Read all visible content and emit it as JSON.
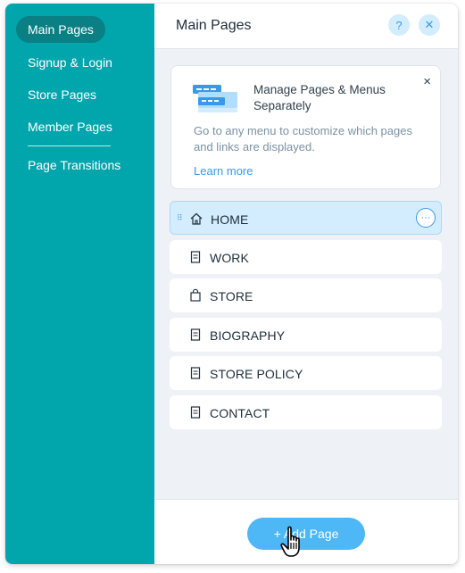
{
  "sidebar": {
    "items": [
      {
        "label": "Main Pages",
        "active": true
      },
      {
        "label": "Signup & Login",
        "active": false
      },
      {
        "label": "Store Pages",
        "active": false
      },
      {
        "label": "Member Pages",
        "active": false
      },
      {
        "label": "Page Transitions",
        "active": false
      }
    ]
  },
  "header": {
    "title": "Main Pages",
    "help_icon": "?",
    "close_icon": "✕"
  },
  "info_card": {
    "heading": "Manage Pages & Menus Separately",
    "body": "Go to any menu to customize which pages and links are displayed.",
    "link": "Learn more",
    "close_icon": "×"
  },
  "pages": [
    {
      "label": "HOME",
      "icon": "home-icon",
      "selected": true
    },
    {
      "label": "WORK",
      "icon": "page-icon",
      "selected": false
    },
    {
      "label": "STORE",
      "icon": "shopping-bag-icon",
      "selected": false
    },
    {
      "label": "BIOGRAPHY",
      "icon": "page-icon",
      "selected": false
    },
    {
      "label": "STORE POLICY",
      "icon": "page-icon",
      "selected": false
    },
    {
      "label": "CONTACT",
      "icon": "page-icon",
      "selected": false
    }
  ],
  "footer": {
    "add_page_label": "+ Add Page"
  },
  "colors": {
    "sidebar_bg": "#00a6ac",
    "sidebar_active": "#0a7f84",
    "accent": "#3899ec",
    "button": "#4eb7f5",
    "selected_row": "#d3edff"
  }
}
